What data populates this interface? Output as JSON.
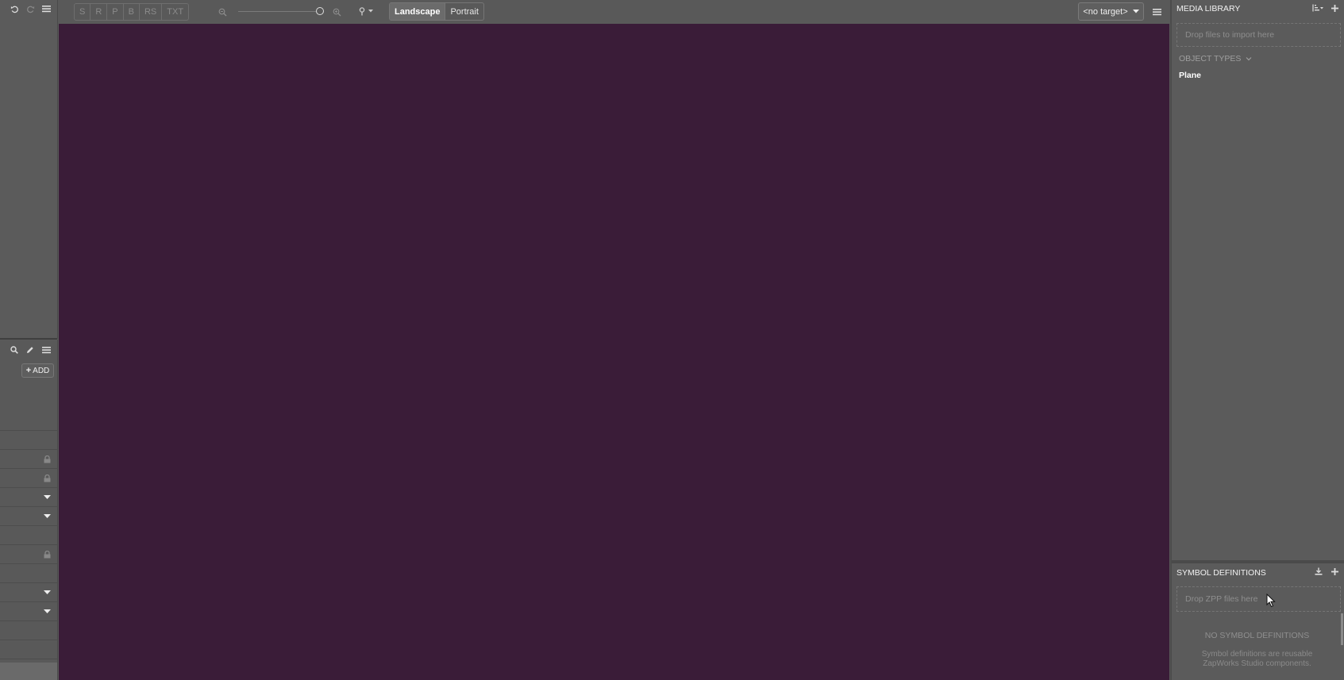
{
  "toolbar": {
    "modes": [
      "S",
      "R",
      "P",
      "B",
      "RS",
      "TXT"
    ],
    "orientation": {
      "options": [
        "Landscape",
        "Portrait"
      ],
      "selected": "Landscape"
    },
    "target_select": "<no target>"
  },
  "left_panel": {
    "add_label": "ADD"
  },
  "media_library": {
    "title": "MEDIA LIBRARY",
    "drop_placeholder": "Drop files to import here",
    "object_types_label": "OBJECT TYPES",
    "object_types": [
      "Plane"
    ]
  },
  "symbol_definitions": {
    "title": "SYMBOL DEFINITIONS",
    "drop_placeholder": "Drop ZPP files here",
    "empty_title": "NO SYMBOL DEFINITIONS",
    "empty_desc_line1": "Symbol definitions are reusable",
    "empty_desc_line2": "ZapWorks Studio components."
  },
  "colors": {
    "canvas_bg": "#3a1c38",
    "panel_bg": "#5b5b5b"
  }
}
